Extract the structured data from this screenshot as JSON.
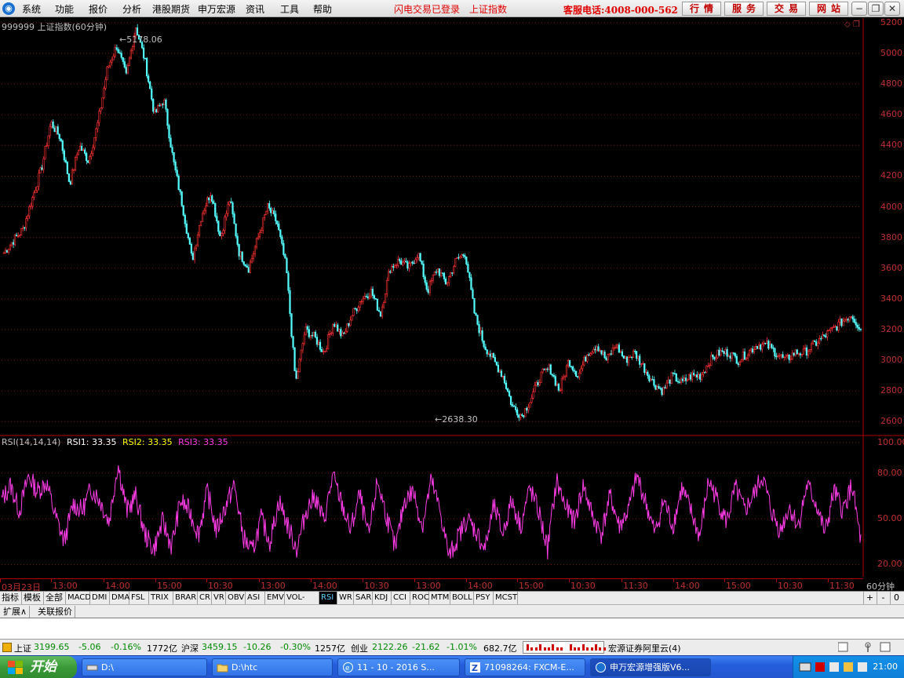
{
  "menu": {
    "items": [
      "系统",
      "功能",
      "报价",
      "分析",
      "港股期货",
      "申万宏源",
      "资讯",
      "工具",
      "帮助"
    ],
    "login_status": "闪电交易已登录",
    "index_link": "上证指数",
    "hotline": "客服电话:4008-000-562",
    "buttons": [
      "行情",
      "服务",
      "交易",
      "网站"
    ]
  },
  "chart": {
    "title": "999999 上证指数(60分钟)",
    "peak_label": "5178.06",
    "trough_label": "2638.30",
    "rsi_legend": {
      "name": "RSI(14,14,14)",
      "rsi1": "RSI1: 33.35",
      "rsi2": "RSI2: 33.35",
      "rsi3": "RSI3: 33.35"
    },
    "period": "60分钟",
    "time_labels": [
      "03月23日",
      "13:00",
      "14:00",
      "15:00",
      "10:30",
      "13:00",
      "14:00",
      "10:30",
      "13:00",
      "14:00",
      "15:00",
      "10:30",
      "11:30",
      "14:00",
      "15:00",
      "10:30",
      "11:30"
    ]
  },
  "chart_data": [
    {
      "type": "candlestick",
      "title": "999999 上证指数(60分钟)",
      "y_ticks": [
        5200,
        5000,
        4800,
        4600,
        4400,
        4200,
        4000,
        3800,
        3600,
        3400,
        3200,
        3000,
        2800,
        2600
      ],
      "ylim": [
        2520,
        5230
      ],
      "annotations": [
        {
          "label": "5178.06",
          "value": 5178.06
        },
        {
          "label": "2638.30",
          "value": 2638.3
        }
      ],
      "up_color": "#ff3232",
      "down_color": "#54ffff",
      "grid": true,
      "close_path": [
        3700,
        3780,
        3850,
        4050,
        4250,
        4550,
        4450,
        4150,
        4400,
        4300,
        4550,
        4900,
        5050,
        4850,
        5178.06,
        4950,
        4600,
        4700,
        4300,
        4000,
        3650,
        3950,
        4100,
        3800,
        4050,
        3700,
        3600,
        3800,
        4000,
        3900,
        3600,
        2850,
        3200,
        3150,
        3050,
        3250,
        3150,
        3300,
        3400,
        3450,
        3300,
        3600,
        3650,
        3600,
        3700,
        3450,
        3600,
        3500,
        3650,
        3700,
        3300,
        3100,
        3000,
        2900,
        2700,
        2638.3,
        2750,
        2900,
        2950,
        2800,
        3000,
        2900,
        3050,
        3100,
        3000,
        3100,
        3000,
        3050,
        2950,
        2850,
        2800,
        2900,
        2850,
        2900,
        2900,
        3000,
        3050,
        3050,
        3000,
        3050,
        3100,
        3100,
        3050,
        3000,
        3050,
        3050,
        3100,
        3150,
        3200,
        3250,
        3300,
        3200
      ]
    },
    {
      "type": "line",
      "title": "RSI(14,14,14)",
      "y_ticks": [
        100,
        80,
        50,
        20
      ],
      "ylim": [
        12,
        104
      ],
      "series": [
        {
          "name": "RSI1",
          "color": "#ff3ce8",
          "values": [
            62,
            72,
            55,
            78,
            68,
            74,
            52,
            35,
            60,
            55,
            70,
            62,
            48,
            86,
            55,
            65,
            40,
            30,
            48,
            32,
            62,
            55,
            40,
            68,
            42,
            58,
            72,
            38,
            28,
            50,
            35,
            62,
            45,
            30,
            55,
            65,
            48,
            78,
            60,
            42,
            66,
            38,
            75,
            52,
            30,
            62,
            68,
            45,
            75,
            55,
            25,
            38,
            50,
            42,
            30,
            58,
            40,
            62,
            45,
            70,
            55,
            30,
            75,
            58,
            48,
            72,
            52,
            40,
            65,
            45,
            55,
            78,
            60,
            40,
            62,
            45,
            70,
            55,
            38,
            75,
            62,
            48,
            70,
            55,
            65,
            78,
            55,
            42,
            58,
            45,
            72,
            60,
            40,
            68,
            55,
            72,
            35
          ]
        },
        {
          "name": "RSI2",
          "color": "#ffff00",
          "values": []
        },
        {
          "name": "RSI3",
          "color": "#ff3ce8",
          "values": []
        }
      ]
    }
  ],
  "indicator_tabs": [
    "指标",
    "模板",
    "全部",
    "MACD",
    "DMI",
    "DMA",
    "FSL",
    "TRIX",
    "BRAR",
    "CR",
    "VR",
    "OBV",
    "ASI",
    "EMV",
    "VOL-TDX",
    "RSI",
    "WR",
    "SAR",
    "KDJ",
    "CCI",
    "ROC",
    "MTM",
    "BOLL",
    "PSY",
    "MCST"
  ],
  "active_indicator": "RSI",
  "indicator_controls": [
    "+",
    "-",
    "0"
  ],
  "sub_tabs": [
    "扩展∧",
    "关联报价"
  ],
  "status_bar": {
    "sh_label": "上证",
    "sh_value": "3199.65",
    "sh_change": "-5.06",
    "sh_pct": "-0.16%",
    "sh_amount": "1772亿",
    "hs_label": "沪深",
    "hs_value": "3459.15",
    "hs_change": "-10.26",
    "hs_pct": "-0.30%",
    "hs_amount": "1257亿",
    "cy_label": "创业",
    "cy_value": "2122.26",
    "cy_change": "-21.62",
    "cy_pct": "-1.01%",
    "cy_amount": "682.7亿",
    "server": "宏源证券阿里云(4)"
  },
  "taskbar": {
    "start": "开始",
    "tasks": [
      "D:\\",
      "D:\\htc",
      "11 - 10 - 2016 S...",
      "71098264: FXCM-E...",
      "申万宏源增强版V6..."
    ],
    "clock": "21:00"
  }
}
